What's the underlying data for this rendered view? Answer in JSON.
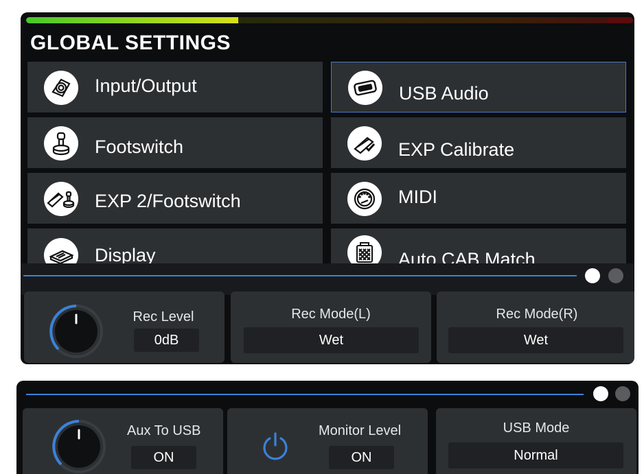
{
  "global_settings": {
    "title": "GLOBAL SETTINGS",
    "level_meter": {
      "lit_fraction": 0.35
    },
    "items": [
      {
        "label": "Input/Output",
        "icon": "jack-socket-icon",
        "selected": false
      },
      {
        "label": "USB Audio",
        "icon": "usb-port-icon",
        "selected": true
      },
      {
        "label": "Footswitch",
        "icon": "footswitch-icon",
        "selected": false
      },
      {
        "label": "EXP Calibrate",
        "icon": "expression-pedal-check-icon",
        "selected": false
      },
      {
        "label": "EXP 2/Footswitch",
        "icon": "pedal-footswitch-icon",
        "selected": false
      },
      {
        "label": "MIDI",
        "icon": "midi-port-icon",
        "selected": false
      },
      {
        "label": "Display",
        "icon": "display-icon",
        "selected": false
      },
      {
        "label": "Auto CAB Match",
        "icon": "cabinet-icon",
        "selected": false
      }
    ]
  },
  "usb_audio_page1": {
    "page_index": 1,
    "page_count": 2,
    "rec_level": {
      "label": "Rec Level",
      "value": "0dB"
    },
    "rec_mode_l": {
      "label": "Rec Mode(L)",
      "value": "Wet"
    },
    "rec_mode_r": {
      "label": "Rec Mode(R)",
      "value": "Wet"
    }
  },
  "usb_audio_page2": {
    "page_index": 1,
    "page_count": 2,
    "aux_to_usb": {
      "label": "Aux To USB",
      "value": "ON"
    },
    "monitor_level": {
      "label": "Monitor Level",
      "value": "ON"
    },
    "usb_mode": {
      "label": "USB Mode",
      "value": "Normal"
    }
  },
  "colors": {
    "accent": "#3b82d8",
    "tile": "#2d3033",
    "background": "#0c0d0f"
  }
}
